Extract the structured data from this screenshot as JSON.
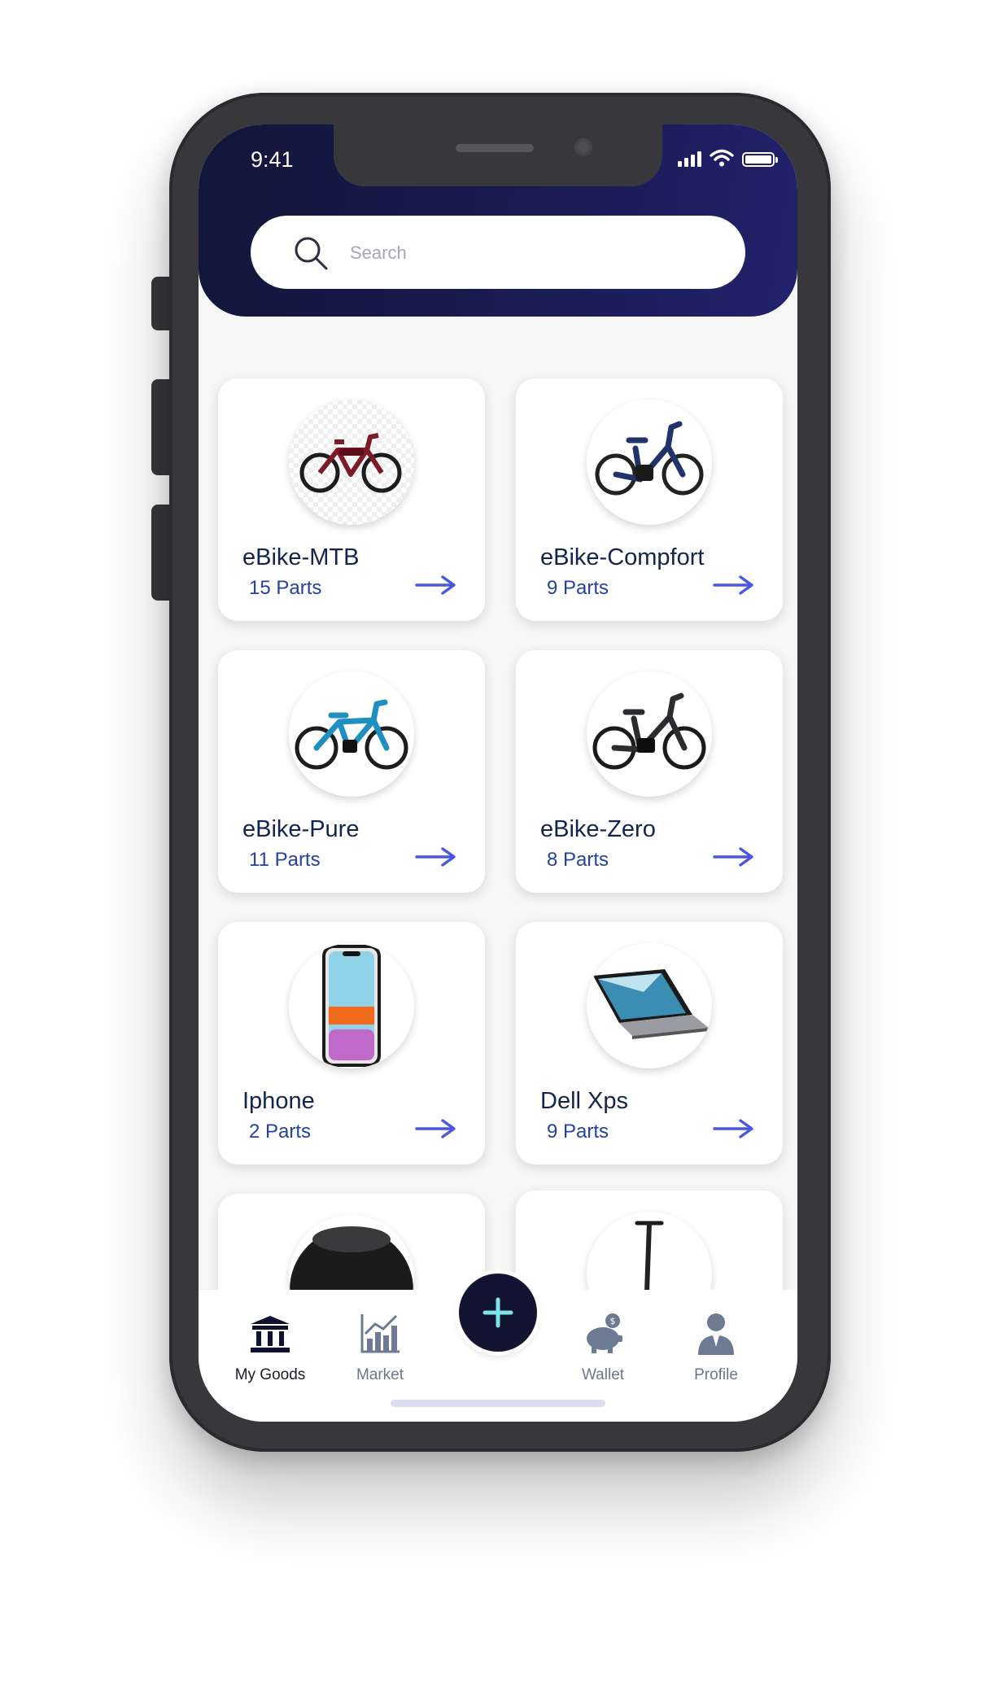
{
  "status": {
    "time": "9:41"
  },
  "search": {
    "placeholder": "Search"
  },
  "items": [
    {
      "title": "eBike-MTB",
      "parts": "15 Parts",
      "icon": "bike-red-icon"
    },
    {
      "title": "eBike-Compfort",
      "parts": "9 Parts",
      "icon": "bike-navy-icon"
    },
    {
      "title": "eBike-Pure",
      "parts": "11 Parts",
      "icon": "bike-blue-icon"
    },
    {
      "title": "eBike-Zero",
      "parts": "8 Parts",
      "icon": "bike-black-icon"
    },
    {
      "title": "Iphone",
      "parts": "2 Parts",
      "icon": "iphone-icon"
    },
    {
      "title": "Dell Xps",
      "parts": "9 Parts",
      "icon": "laptop-icon"
    }
  ],
  "tabs": [
    {
      "label": "My Goods",
      "icon": "bank-icon",
      "active": true
    },
    {
      "label": "Market",
      "icon": "chart-icon",
      "active": false
    },
    {
      "label": "Wallet",
      "icon": "piggy-bank-icon",
      "active": false
    },
    {
      "label": "Profile",
      "icon": "user-icon",
      "active": false
    }
  ],
  "colors": {
    "header": "#1a1c55",
    "accent": "#4a57e0",
    "fab": "#121432",
    "fab_plus": "#7fe3ea"
  }
}
